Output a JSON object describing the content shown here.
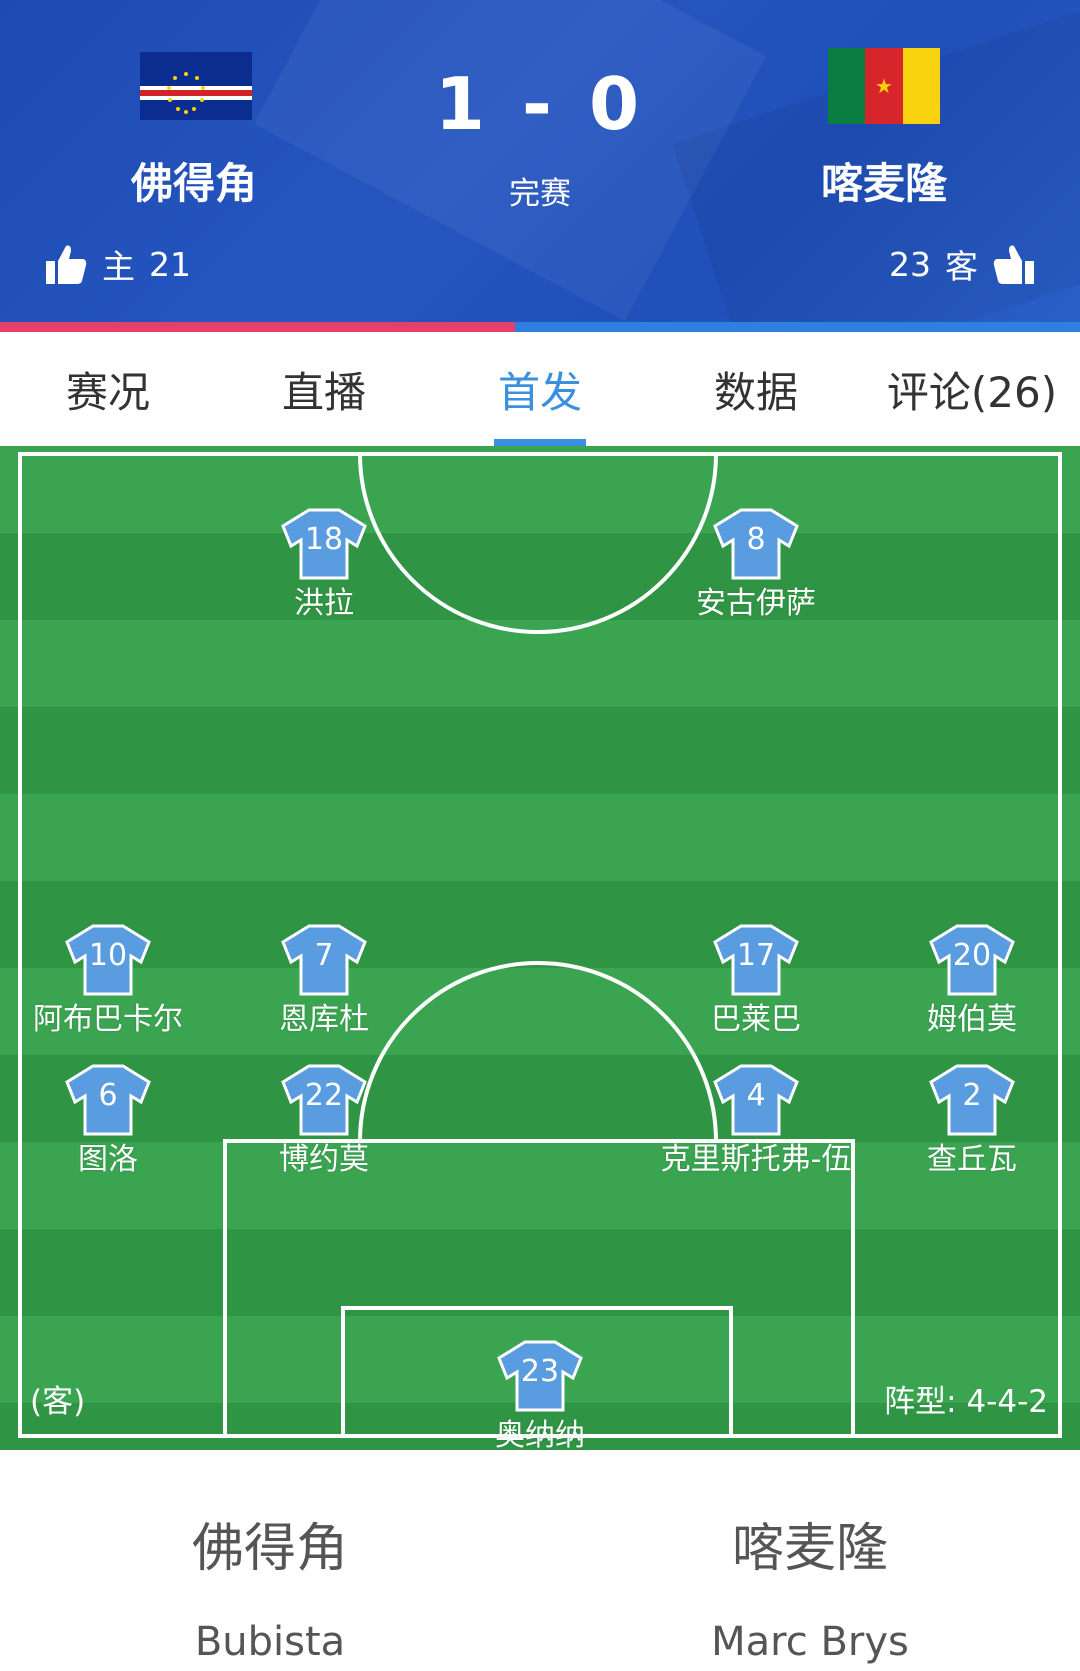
{
  "match": {
    "home": {
      "name": "佛得角",
      "likes_label": "主",
      "likes": "21",
      "flag": "cape-verde-flag"
    },
    "away": {
      "name": "喀麦隆",
      "likes_label": "客",
      "likes": "23",
      "flag": "cameroon-flag"
    },
    "score": "1 - 0",
    "status": "完赛"
  },
  "tabs": [
    {
      "label": "赛况",
      "active": false
    },
    {
      "label": "直播",
      "active": false
    },
    {
      "label": "首发",
      "active": true
    },
    {
      "label": "数据",
      "active": false
    },
    {
      "label": "评论(26)",
      "active": false
    }
  ],
  "pitch": {
    "side_label": "(客)",
    "formation": "阵型: 4-4-2",
    "players": [
      {
        "number": "18",
        "name": "洪拉"
      },
      {
        "number": "8",
        "name": "安古伊萨"
      },
      {
        "number": "10",
        "name": "阿布巴卡尔"
      },
      {
        "number": "7",
        "name": "恩库杜"
      },
      {
        "number": "17",
        "name": "巴莱巴"
      },
      {
        "number": "20",
        "name": "姆伯莫"
      },
      {
        "number": "6",
        "name": "图洛"
      },
      {
        "number": "22",
        "name": "博约莫"
      },
      {
        "number": "4",
        "name": "克里斯托弗-伍"
      },
      {
        "number": "2",
        "name": "查丘瓦"
      },
      {
        "number": "23",
        "name": "奥纳纳"
      }
    ]
  },
  "coaches": {
    "home": {
      "team": "佛得角",
      "coach": "Bubista"
    },
    "away": {
      "team": "喀麦隆",
      "coach": "Marc Brys"
    }
  },
  "colors": {
    "header_bg": "#2556c0",
    "accent": "#3b8fe0",
    "home_bar": "#e4406a",
    "away_bar": "#2e7fe0",
    "pitch_light": "#3aa451",
    "pitch_dark": "#2f9444",
    "jersey": "#5a9ce0"
  }
}
